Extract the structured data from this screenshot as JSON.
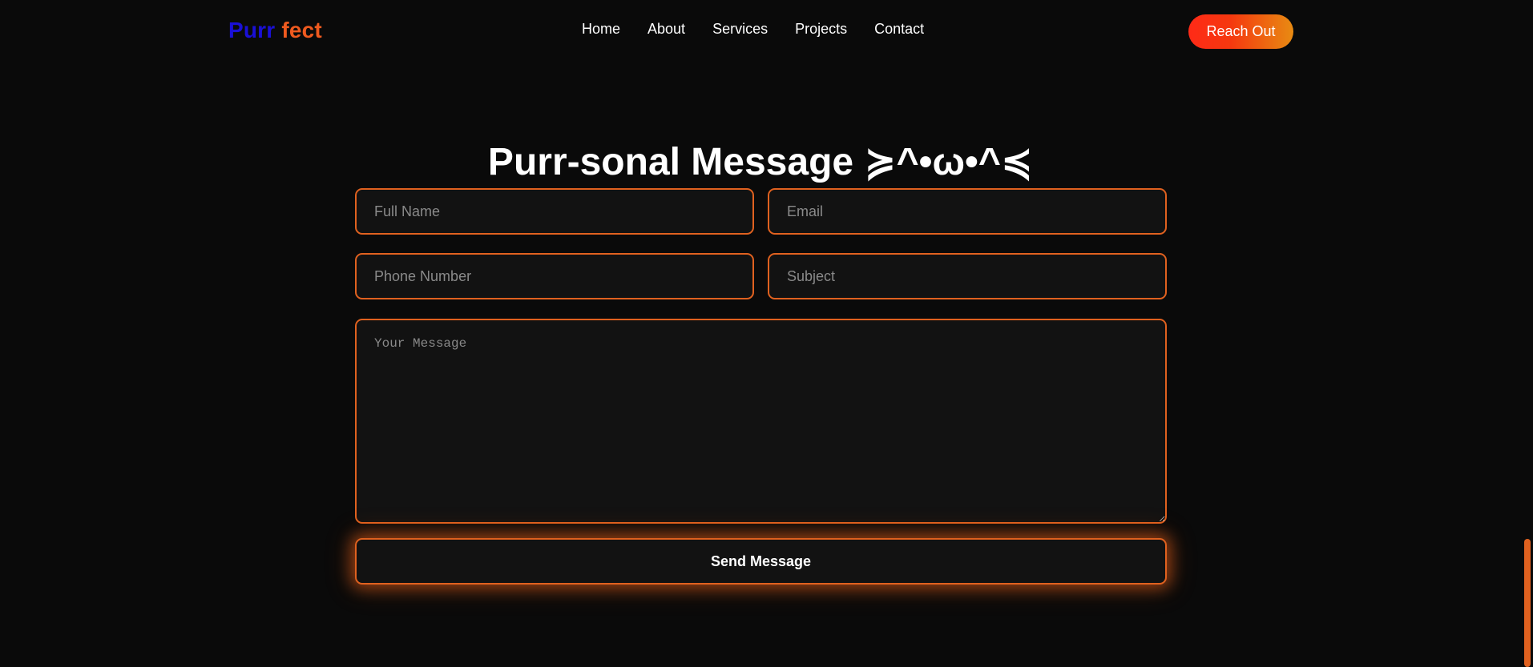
{
  "header": {
    "logo_part1": "Purr",
    "logo_part2": "fect",
    "nav": [
      "Home",
      "About",
      "Services",
      "Projects",
      "Contact"
    ],
    "cta_label": "Reach Out"
  },
  "form": {
    "title": "Purr-sonal Message ≽^•ω•^≼",
    "full_name_placeholder": "Full Name",
    "email_placeholder": "Email",
    "phone_placeholder": "Phone Number",
    "subject_placeholder": "Subject",
    "message_placeholder": "Your Message",
    "submit_label": "Send Message"
  },
  "colors": {
    "background": "#0a0a0a",
    "accent": "#e0611f",
    "logo_blue": "#1a10d6",
    "logo_orange": "#ef5a1f"
  }
}
